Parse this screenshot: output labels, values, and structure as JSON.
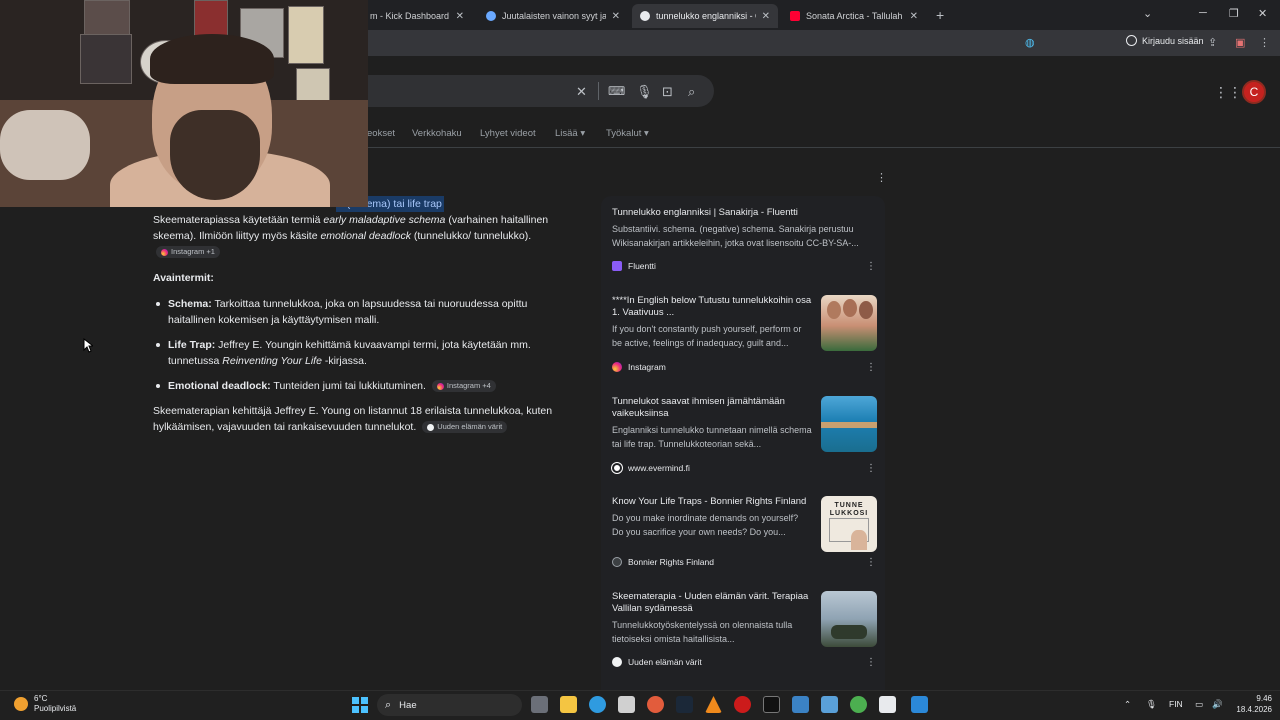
{
  "browser": {
    "tabs": [
      {
        "title": "m - Kick Dashboard",
        "active": false
      },
      {
        "title": "Juutalaisten vainon syyt ja aika",
        "active": false
      },
      {
        "title": "tunnelukko englanniksi - Goog",
        "active": true
      },
      {
        "title": "Sonata Arctica - Tallulah - YouT",
        "active": false
      }
    ],
    "new_tab": "+",
    "signin_label": "Kirjaudu sisään"
  },
  "header": {
    "avatar_letter": "C",
    "nav_tabs": [
      "eokset",
      "Verkkohaku",
      "Lyhyet videot",
      "Lisää",
      "Työkalut"
    ]
  },
  "overview": {
    "top_highlight": "a (skeema) tai life trap",
    "intro": {
      "a": "Skeematerapiassa käytetään termiä ",
      "b": "early maladaptive schema",
      "c": " (varhainen haitallinen skeema). Ilmiöön liittyy myös käsite ",
      "d": "emotional deadlock",
      "e": " (tunnelukko/ tunnelukko).",
      "chip": "Instagram +1"
    },
    "terms_title": "Avaintermit:",
    "terms": [
      {
        "term": "Schema:",
        "text": " Tarkoittaa tunnelukkoa, joka on lapsuudessa tai nuoruudessa opittu haitallinen kokemisen ja käyttäytymisen malli."
      },
      {
        "term": "Life Trap:",
        "text_a": " Jeffrey E. Youngin kehittämä kuvaavampi termi, jota käytetään mm. tunnetussa ",
        "em": "Reinventing Your Life",
        "text_b": " -kirjassa."
      },
      {
        "term": "Emotional deadlock:",
        "text": " Tunteiden jumi tai lukkiutuminen.",
        "chip": "Instagram +4"
      }
    ],
    "closing": "Skeematerapian kehittäjä Jeffrey E. Young on listannut 18 erilaista tunnelukkoa, kuten hylkäämisen, vajavuuden tai rankaisevuuden tunnelukot.",
    "closing_chip": "Uuden elämän värit"
  },
  "sources": [
    {
      "title": "Tunnelukko englanniksi | Sanakirja - Fluentti",
      "snippet": "Substantiivi. schema. (negative) schema. Sanakirja perustuu Wikisanakirjan artikkeleihin, jotka ovat lisensoitu CC-BY-SA-...",
      "site": "Fluentti"
    },
    {
      "title": "****In English below Tutustu tunnelukkoihin osa 1. Vaativuus ...",
      "snippet": "If you don't constantly push yourself, perform or be active, feelings of inadequacy, guilt and...",
      "site": "Instagram"
    },
    {
      "title": "Tunnelukot saavat ihmisen jämähtämään vaikeuksiinsa",
      "snippet": "Englanniksi tunnelukko tunnetaan nimellä schema tai life trap. Tunnelukkoteorian sekä...",
      "site": "www.evermind.fi"
    },
    {
      "title": "Know Your Life Traps - Bonnier Rights Finland",
      "snippet": "Do you make inordinate demands on yourself? Do you sacrifice your own needs? Do you...",
      "site": "Bonnier Rights Finland"
    },
    {
      "title": "Skeematerapia - Uuden elämän värit. Terapiaa Vallilan sydämessä",
      "snippet": "Tunnelukkotyöskentelyssä on olennaista tulla tietoiseksi omista haitallisista...",
      "site": "Uuden elämän värit"
    }
  ],
  "thumbs": {
    "book": "TUNNE LUKKOSI"
  },
  "taskbar": {
    "temp": "6°C",
    "weather_text": "Puolipilvistä",
    "search_label": "Hae",
    "lang": "FIN",
    "time": "9.46",
    "date": "18.4.2026"
  },
  "colors": {
    "accent_blue": "#a8c7fa",
    "avatar_red": "#c5221f",
    "bg": "#1f1f1f"
  }
}
